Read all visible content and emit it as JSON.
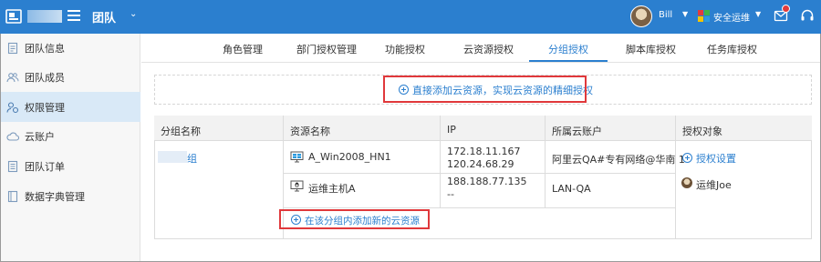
{
  "header": {
    "team": "团队",
    "user": "Bill",
    "role": "安全运维"
  },
  "sidebar": {
    "items": [
      {
        "label": "团队信息",
        "icon": "doc-icon"
      },
      {
        "label": "团队成员",
        "icon": "users-icon"
      },
      {
        "label": "权限管理",
        "icon": "user-lock-icon",
        "active": true
      },
      {
        "label": "云账户",
        "icon": "cloud-icon"
      },
      {
        "label": "团队订单",
        "icon": "order-icon"
      },
      {
        "label": "数据字典管理",
        "icon": "dictionary-icon"
      }
    ]
  },
  "tabs": [
    {
      "label": "角色管理"
    },
    {
      "label": "部门授权管理"
    },
    {
      "label": "功能授权"
    },
    {
      "label": "云资源授权"
    },
    {
      "label": "分组授权",
      "active": true
    },
    {
      "label": "脚本库授权"
    },
    {
      "label": "任务库授权"
    }
  ],
  "banner": {
    "link": "直接添加云资源，实现云资源的精细授权"
  },
  "table": {
    "headers": [
      "分组名称",
      "资源名称",
      "IP",
      "所属云账户",
      "授权对象"
    ],
    "group_name": "组",
    "rows": [
      {
        "name": "A_Win2008_HN1",
        "ip1": "172.18.11.167",
        "ip2": "120.24.68.29",
        "account": "阿里云QA#专有网络@华南 1",
        "icon": "windows-icon"
      },
      {
        "name": "运维主机A",
        "ip1": "188.188.77.135",
        "ip2": "--",
        "account": "LAN-QA",
        "icon": "linux-icon"
      }
    ],
    "grant_link": "授权设置",
    "grant_user": "运维Joe",
    "add_in_group": "在该分组内添加新的云资源"
  },
  "colors": {
    "primary": "#2b7fcf",
    "highlight": "#e0383b",
    "active_bg": "#d9e9f7"
  }
}
